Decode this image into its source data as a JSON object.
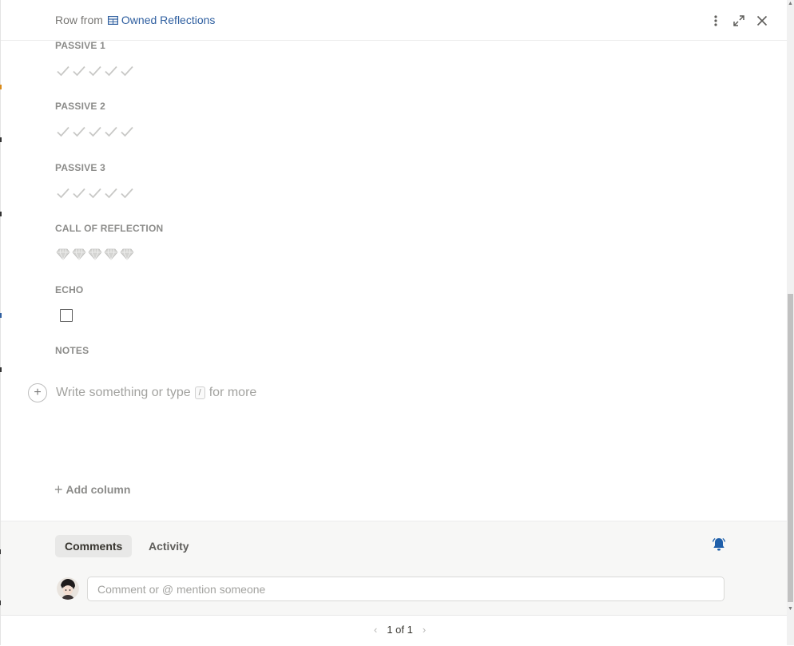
{
  "header": {
    "prefix": "Row from",
    "table_link": "Owned Reflections"
  },
  "fields": [
    {
      "label": "PASSIVE 1",
      "type": "rating",
      "icon": "check-icon",
      "max": 5,
      "value": 0
    },
    {
      "label": "PASSIVE 2",
      "type": "rating",
      "icon": "check-icon",
      "max": 5,
      "value": 0
    },
    {
      "label": "PASSIVE 3",
      "type": "rating",
      "icon": "check-icon",
      "max": 5,
      "value": 0
    },
    {
      "label": "CALL OF REFLECTION",
      "type": "rating",
      "icon": "diamond-icon",
      "max": 5,
      "value": 0
    },
    {
      "label": "ECHO",
      "type": "checkbox",
      "checked": false
    },
    {
      "label": "NOTES",
      "type": "text"
    }
  ],
  "editor": {
    "placeholder_before": "Write something or type",
    "slash": "/",
    "placeholder_after": "for more"
  },
  "add_column_label": "Add column",
  "tabs": {
    "comments": "Comments",
    "activity": "Activity"
  },
  "comment": {
    "placeholder": "Comment or @ mention someone"
  },
  "pager": {
    "text": "1 of 1"
  },
  "colors": {
    "accent": "#2f5fa0",
    "bell": "#1f5faa",
    "rating_empty": "#c8c8c6"
  }
}
